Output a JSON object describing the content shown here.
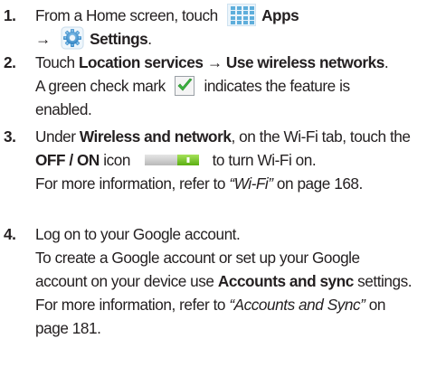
{
  "steps": [
    {
      "number": "1.",
      "lines": [
        {
          "pre": "From a Home screen, touch ",
          "icon": "apps-grid-icon",
          "bold": "Apps"
        },
        {
          "arrow": "→ ",
          "icon": "settings-gear-icon",
          "bold": "Settings",
          "post": "."
        }
      ]
    },
    {
      "number": "2.",
      "lines": [
        {
          "pre": "Touch ",
          "bold": "Location services → Use wireless networks",
          "post": "."
        },
        {
          "pre": "A green check mark ",
          "icon": "check-mark-icon",
          "post": " indicates the feature is"
        },
        {
          "pre": "enabled."
        }
      ]
    },
    {
      "number": "3.",
      "lines": [
        {
          "pre": "Under ",
          "bold": "Wireless and network",
          "post": ", on the Wi-Fi tab, touch the"
        },
        {
          "bold": "OFF / ON",
          "post_mid": " icon ",
          "icon": "toggle-on-icon",
          "post": " to turn Wi-Fi on."
        },
        {
          "pre": "For more information, refer to ",
          "italic": "“Wi-Fi”",
          "post": " on page 168."
        }
      ]
    },
    {
      "number": "4.",
      "lines": [
        {
          "pre": "Log on to your Google account."
        },
        {
          "pre": "To create a Google account or set up your Google"
        },
        {
          "pre": "account on your device use ",
          "bold": "Accounts and sync",
          "post": " settings."
        },
        {
          "pre": "For more information, refer to ",
          "italic": "“Accounts and Sync”",
          "post": " on"
        },
        {
          "pre": "page 181."
        }
      ]
    }
  ],
  "colors": {
    "text": "#231f20",
    "apps_icon": "#5eaedb",
    "gear_icon": "#3a8fd0",
    "check_mark": "#3bb53f",
    "toggle_on": "#6cc21e"
  }
}
